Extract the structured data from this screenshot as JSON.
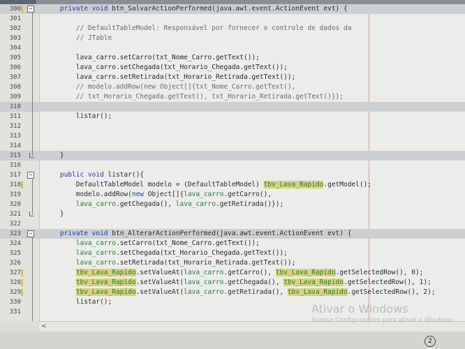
{
  "editor": {
    "lines": [
      {
        "num": "300",
        "fold": "open",
        "hl": true,
        "bracket": true,
        "segs": [
          {
            "t": "    "
          },
          {
            "t": "private void",
            "c": "kw"
          },
          {
            "t": " btn_SalvarActionPerformed(java.awt.event.ActionEvent evt) {"
          }
        ]
      },
      {
        "num": "301",
        "segs": []
      },
      {
        "num": "302",
        "segs": [
          {
            "t": "        "
          },
          {
            "t": "// DefaultTableModel: Responsável por fornecer o controle de dados da",
            "c": "cm"
          }
        ]
      },
      {
        "num": "303",
        "segs": [
          {
            "t": "        "
          },
          {
            "t": "// JTable",
            "c": "cm"
          }
        ]
      },
      {
        "num": "304",
        "segs": []
      },
      {
        "num": "305",
        "segs": [
          {
            "t": "        lava_carro.setCarro(txt_Nome_Carro.getText());"
          }
        ]
      },
      {
        "num": "306",
        "segs": [
          {
            "t": "        lava_carro.setChegada(txt_Horario_Chegada.getText());"
          }
        ]
      },
      {
        "num": "307",
        "segs": [
          {
            "t": "        lava_carro.setRetirada(txt_Horario_Retirada.getText());"
          }
        ]
      },
      {
        "num": "308",
        "segs": [
          {
            "t": "        "
          },
          {
            "t": "// modelo.addRow(new Object[]{txt_Nome_Carro.getText(),",
            "c": "cm"
          }
        ]
      },
      {
        "num": "309",
        "segs": [
          {
            "t": "        "
          },
          {
            "t": "// txt_Horario_Chegada.getText(), txt_Horario_Retirada.getText()});",
            "c": "cm"
          }
        ]
      },
      {
        "num": "310",
        "hl": true,
        "segs": []
      },
      {
        "num": "311",
        "segs": [
          {
            "t": "        listar();"
          }
        ]
      },
      {
        "num": "312",
        "segs": []
      },
      {
        "num": "313",
        "segs": []
      },
      {
        "num": "314",
        "segs": []
      },
      {
        "num": "315",
        "fold": "end",
        "hl": true,
        "segs": [
          {
            "t": "    }"
          }
        ]
      },
      {
        "num": "316",
        "segs": []
      },
      {
        "num": "317",
        "fold": "open",
        "segs": [
          {
            "t": "    "
          },
          {
            "t": "public void",
            "c": "kw"
          },
          {
            "t": " listar(){"
          }
        ]
      },
      {
        "num": "318",
        "bracket": true,
        "segs": [
          {
            "t": "        DefaultTableModel modelo = (DefaultTableModel) "
          },
          {
            "t": "tbv_Lava_Rapido",
            "c": "hlword"
          },
          {
            "t": ".getModel();"
          }
        ]
      },
      {
        "num": "319",
        "segs": [
          {
            "t": "        modelo.addRow("
          },
          {
            "t": "new",
            "c": "kw"
          },
          {
            "t": " Object[]{"
          },
          {
            "t": "lava_carro",
            "c": "fld"
          },
          {
            "t": ".getCarro(),"
          }
        ]
      },
      {
        "num": "320",
        "segs": [
          {
            "t": "        "
          },
          {
            "t": "lava_carro",
            "c": "fld"
          },
          {
            "t": ".getChegada(), "
          },
          {
            "t": "lava_carro",
            "c": "fld"
          },
          {
            "t": ".getRetirada()});"
          }
        ]
      },
      {
        "num": "321",
        "fold": "end",
        "segs": [
          {
            "t": "    }"
          }
        ]
      },
      {
        "num": "322",
        "segs": []
      },
      {
        "num": "323",
        "fold": "open",
        "hl": true,
        "segs": [
          {
            "t": "    "
          },
          {
            "t": "private void",
            "c": "kw"
          },
          {
            "t": " btn_AlterarActionPerformed(java.awt.event.ActionEvent evt) {"
          }
        ]
      },
      {
        "num": "324",
        "segs": [
          {
            "t": "        "
          },
          {
            "t": "lava_carro",
            "c": "fld"
          },
          {
            "t": ".setCarro(txt_Nome_Carro.getText());"
          }
        ]
      },
      {
        "num": "325",
        "segs": [
          {
            "t": "        "
          },
          {
            "t": "lava_carro",
            "c": "fld"
          },
          {
            "t": ".setChegada(txt_Horario_Chegada.getText());"
          }
        ]
      },
      {
        "num": "326",
        "segs": [
          {
            "t": "        "
          },
          {
            "t": "lava_carro",
            "c": "fld"
          },
          {
            "t": ".setRetirada(txt_Horario_Retirada.getText());"
          }
        ]
      },
      {
        "num": "327",
        "bracket": true,
        "segs": [
          {
            "t": "        "
          },
          {
            "t": "tbv_Lava_Rapido",
            "c": "hlword"
          },
          {
            "t": ".setValueAt("
          },
          {
            "t": "lava_carro",
            "c": "fld"
          },
          {
            "t": ".getCarro(), "
          },
          {
            "t": "tbv_Lava_Rapido",
            "c": "hlword"
          },
          {
            "t": ".getSelectedRow(), 0);"
          }
        ]
      },
      {
        "num": "328",
        "bracket": true,
        "segs": [
          {
            "t": "        "
          },
          {
            "t": "tbv_Lava_Rapido",
            "c": "hlword"
          },
          {
            "t": ".setValueAt("
          },
          {
            "t": "lava_carro",
            "c": "fld"
          },
          {
            "t": ".getChegada(), "
          },
          {
            "t": "tbv_Lava_Rapido",
            "c": "hlword"
          },
          {
            "t": ".getSelectedRow(), 1);"
          }
        ]
      },
      {
        "num": "329",
        "bracket": true,
        "segs": [
          {
            "t": "        "
          },
          {
            "t": "tbv_Lava_Rapido",
            "c": "hlword"
          },
          {
            "t": ".setValueAt("
          },
          {
            "t": "lava_carro",
            "c": "fld"
          },
          {
            "t": ".getRetirada(), "
          },
          {
            "t": "tbv_Lava_Rapido",
            "c": "hlword"
          },
          {
            "t": ".getSelectedRow(), 2);"
          }
        ]
      },
      {
        "num": "330",
        "segs": [
          {
            "t": "        listar();"
          }
        ]
      },
      {
        "num": "331",
        "segs": []
      }
    ]
  },
  "watermark": {
    "title": "Ativar o Windows",
    "subtitle": "Acesse Configurações para ativar o Windows."
  },
  "statusbar": {
    "badge": "2"
  },
  "colors": {
    "keyword": "#1a3fa8",
    "comment": "#6b6b72",
    "field": "#2a7a3c",
    "highlight": "#d8d27a"
  }
}
